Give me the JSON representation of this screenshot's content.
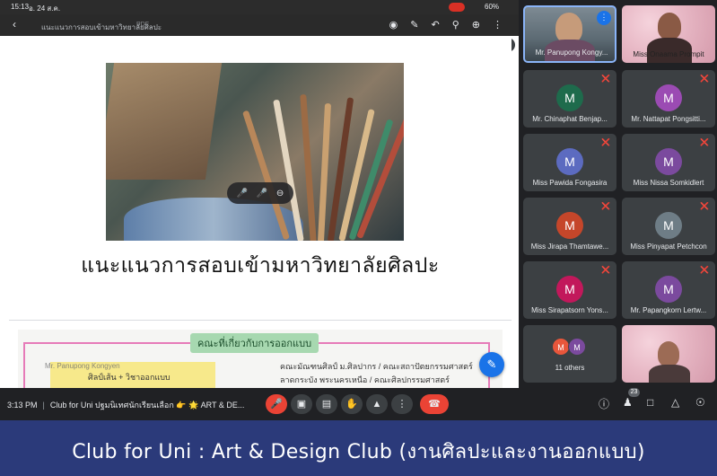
{
  "device_status": {
    "time": "15:13",
    "date": "อ. 24 ส.ค.",
    "battery": "60%"
  },
  "viewer": {
    "back_icon": "arrow-back-icon",
    "doc_title": "แนะแนวการสอบเข้ามหาวิทยาลัยศิลปะ",
    "doc_type": "PDF",
    "page_number": "1"
  },
  "slide1": {
    "title": "แนะแนวการสอบเข้ามหาวิทยาลัยศิลปะ"
  },
  "slide2": {
    "heading": "คณะที่เกี่ยวกับการออกแบบ",
    "presenter_overlay": "Mr. Panupong Kongyen",
    "yellow_box_text": "ศิลป์เส้น + วิชาออกแบบ",
    "faculties_line1": "คณะมัณฑนศิลป์ ม.ศิลปากร / คณะสถาปัตยกรรมศาสตร์",
    "faculties_line2": "ลาดกระบัง พระนครเหนือ / คณะศิลปกรรมศาสตร์"
  },
  "participants": [
    {
      "name": "Mr. Panupong Kongy...",
      "type": "video"
    },
    {
      "name": "Miss Onaama Prompit",
      "type": "video"
    },
    {
      "name": "Mr. Chinaphat Benjap...",
      "initial": "M",
      "color": "#1e6b4c",
      "muted": true
    },
    {
      "name": "Mr. Nattapat Pongsitti...",
      "initial": "M",
      "color": "#9b4bb3",
      "muted": true
    },
    {
      "name": "Miss Pawida Fongasira",
      "initial": "M",
      "color": "#5c6bc0",
      "muted": true
    },
    {
      "name": "Miss Nissa Somkidlert",
      "initial": "M",
      "color": "#7b4a9e",
      "muted": true
    },
    {
      "name": "Miss Jirapa Thamtawe...",
      "initial": "M",
      "color": "#c5462a",
      "muted": true
    },
    {
      "name": "Miss Pinyapat Petchcon",
      "initial": "M",
      "color": "#6e7d86",
      "muted": true
    },
    {
      "name": "Miss Sirapatsorn Yons...",
      "initial": "M",
      "color": "#c2185b",
      "muted": true
    },
    {
      "name": "Mr. Papangkorn Lertw...",
      "initial": "M",
      "color": "#7b4a9e",
      "muted": true
    },
    {
      "name": "11 others",
      "initials": [
        "M",
        "M"
      ],
      "colors": [
        "#e8563b",
        "#7b4a9e"
      ]
    },
    {
      "name": "",
      "type": "video"
    }
  ],
  "meeting_bar": {
    "time": "3:13 PM",
    "title": "Club for Uni ปฐมนิเทศนักเรียนเลือก 👉 🌟 ART & DE...",
    "participant_count": "23",
    "controls": [
      "mic-off-icon",
      "camera-icon",
      "captions-icon",
      "raise-hand-icon",
      "present-icon",
      "more-icon",
      "end-call-icon"
    ],
    "right_icons": [
      "info-icon",
      "people-icon",
      "chat-icon",
      "activities-icon",
      "host-controls-icon"
    ]
  },
  "banner": {
    "caption": "Club for Uni : Art & Design Club (งานศิลปะและงานออกแบบ)"
  },
  "colors": {
    "accent_blue": "#1a73e8",
    "end_call_red": "#ea4335",
    "banner_bg": "#2b3a7a",
    "meet_bg": "#202124"
  }
}
